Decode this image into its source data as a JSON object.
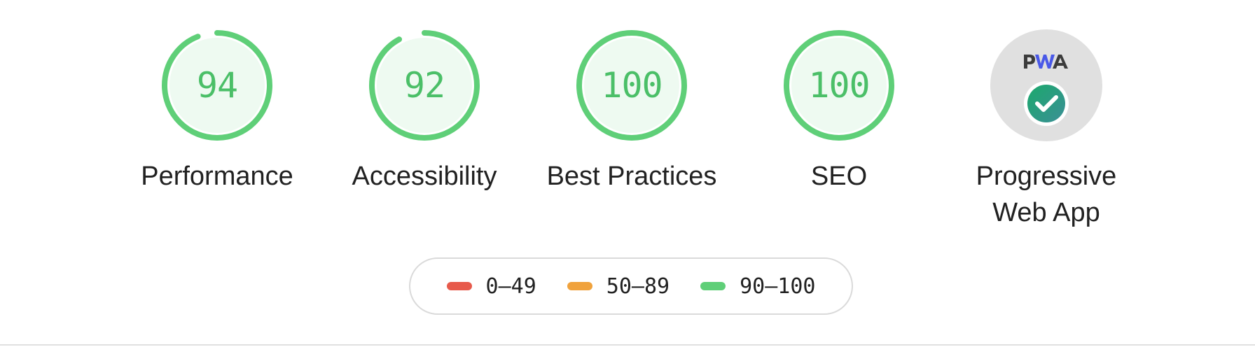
{
  "colors": {
    "pass": "#5fcf78",
    "pass_bg": "#eefaf1",
    "average": "#f0a23c",
    "fail": "#e75a4b",
    "pwa_bg": "#e0e0e0",
    "pwa_check_start": "#1ba96c",
    "pwa_check_end": "#3b8f96"
  },
  "scores": [
    {
      "label": "Performance",
      "value": "94",
      "score": 94
    },
    {
      "label": "Accessibility",
      "value": "92",
      "score": 92
    },
    {
      "label": "Best Practices",
      "value": "100",
      "score": 100
    },
    {
      "label": "SEO",
      "value": "100",
      "score": 100
    }
  ],
  "pwa": {
    "badge_text": "PWA",
    "label": "Progressive Web App",
    "icon": "pwa-check-badge-icon"
  },
  "legend": [
    {
      "range": "0–49",
      "color": "#e75a4b"
    },
    {
      "range": "50–89",
      "color": "#f0a23c"
    },
    {
      "range": "90–100",
      "color": "#5fcf78"
    }
  ]
}
